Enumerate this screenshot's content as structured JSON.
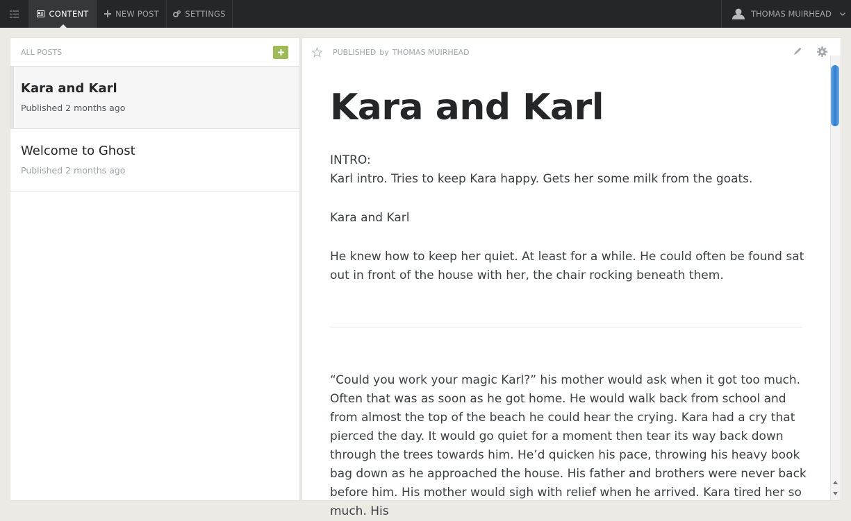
{
  "nav": {
    "tabs": [
      {
        "label": "CONTENT",
        "icon": "content-icon"
      },
      {
        "label": "NEW POST",
        "icon": "plus-icon"
      },
      {
        "label": "SETTINGS",
        "icon": "settings-icon"
      }
    ],
    "user_name": "THOMAS MUIRHEAD"
  },
  "sidebar": {
    "title": "ALL POSTS",
    "posts": [
      {
        "title": "Kara and Karl",
        "meta": "Published 2 months ago"
      },
      {
        "title": "Welcome to Ghost",
        "meta": "Published 2 months ago"
      }
    ]
  },
  "preview": {
    "status": "PUBLISHED",
    "by": "by",
    "author": "THOMAS MUIRHEAD",
    "title": "Kara and Karl",
    "intro_heading": "INTRO:",
    "intro_text": "Karl intro. Tries to keep Kara happy. Gets her some milk from the goats.",
    "subtitle": "Kara and Karl",
    "paragraph1": "He knew how to keep her quiet. At least for a while. He could often be found sat out in front of the house with her, the chair rocking beneath them.",
    "paragraph2": "“Could you work your magic Karl?” his mother would ask when it got too much. Often that was as soon as he got home. He would walk back from school and from almost the top of the beach he could hear the crying. Kara had a cry that pierced the day. It would go quiet for a moment then tear its way back down through the trees towards him. He’d quicken his pace, throwing his heavy book bag down as he approached the house. His father and brothers were never back before him. His mother would sigh with relief when he arrived. Kara tired her so much. His"
  },
  "colors": {
    "topbar": "#242628",
    "accent_green": "#9fbb58",
    "scroll_blue": "#2f7ed4"
  }
}
